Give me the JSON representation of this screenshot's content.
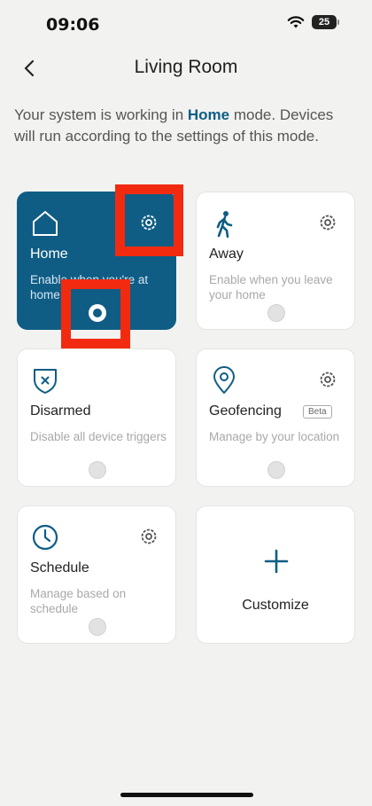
{
  "status": {
    "time": "09:06",
    "battery": "25"
  },
  "nav": {
    "title": "Living Room"
  },
  "intro": {
    "before": "Your system is working in ",
    "mode": "Home",
    "after": " mode. Devices will run according to the settings of this mode."
  },
  "cards": {
    "home": {
      "title": "Home",
      "desc": "Enable when you're at home"
    },
    "away": {
      "title": "Away",
      "desc": "Enable when you leave your home"
    },
    "disarmed": {
      "title": "Disarmed",
      "desc": "Disable all device triggers"
    },
    "geofencing": {
      "title": "Geofencing",
      "badge": "Beta",
      "desc": "Manage by your location"
    },
    "schedule": {
      "title": "Schedule",
      "desc": "Manage based on schedule"
    },
    "customize": {
      "title": "Customize"
    }
  },
  "colors": {
    "accent": "#0f5d85",
    "highlight": "#f22b10",
    "background": "#f2f2f0"
  },
  "icons": [
    "wifi-icon",
    "battery-icon",
    "back-chevron-icon",
    "house-icon",
    "gear-icon",
    "walking-person-icon",
    "shield-x-icon",
    "map-pin-icon",
    "clock-icon",
    "plus-icon"
  ]
}
